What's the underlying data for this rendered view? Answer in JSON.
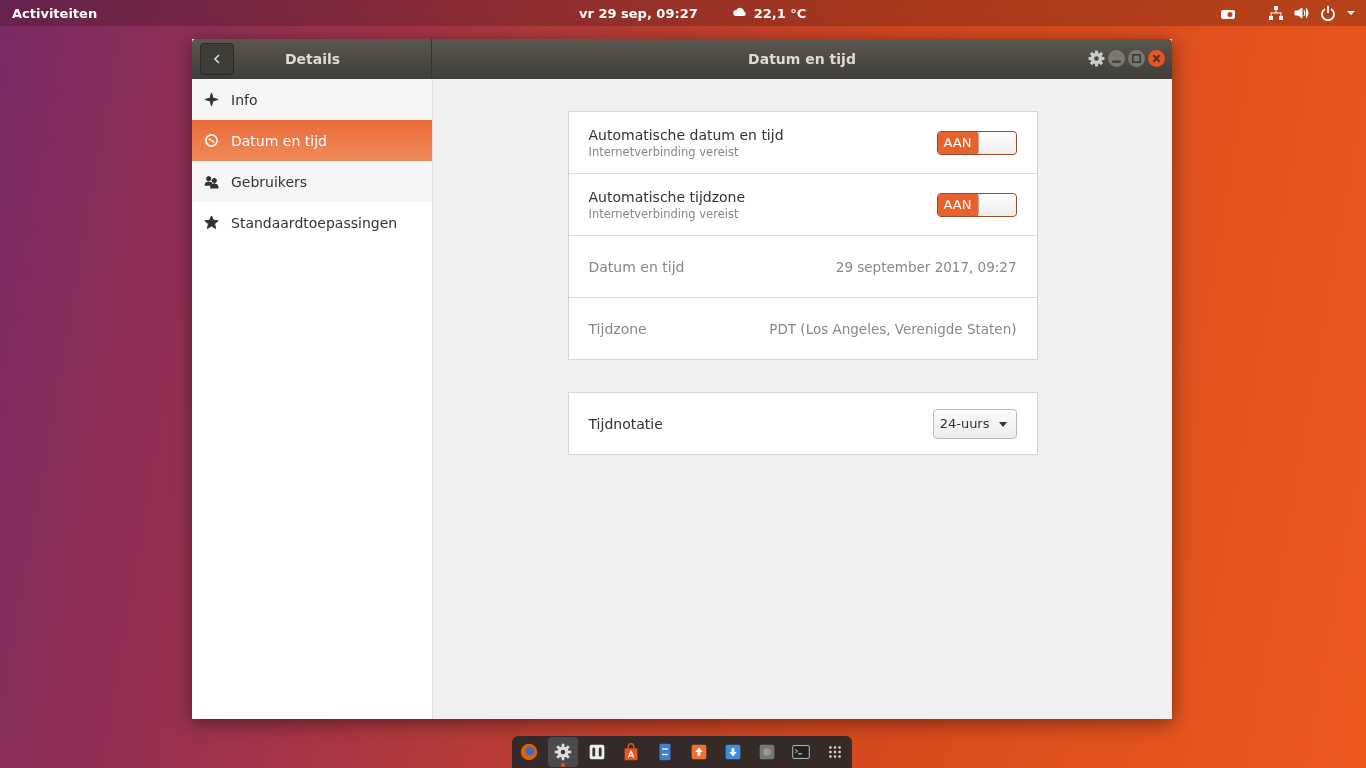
{
  "top_bar": {
    "activities": "Activiteiten",
    "clock": "vr 29 sep, 09:27",
    "weather": "22,1 °C"
  },
  "window": {
    "sidebar_title": "Details",
    "title": "Datum en tijd"
  },
  "sidebar": {
    "items": [
      {
        "label": "Info",
        "selected": false
      },
      {
        "label": "Datum en tijd",
        "selected": true
      },
      {
        "label": "Gebruikers",
        "selected": false
      },
      {
        "label": "Standaardtoepassingen",
        "selected": false
      }
    ]
  },
  "groups": [
    {
      "rows": [
        {
          "kind": "toggle",
          "label": "Automatische datum en tijd",
          "subtitle": "Internetverbinding vereist",
          "on": true,
          "state_text": "AAN"
        },
        {
          "kind": "toggle",
          "label": "Automatische tijdzone",
          "subtitle": "Internetverbinding vereist",
          "on": true,
          "state_text": "AAN"
        },
        {
          "kind": "value",
          "label": "Datum en tijd",
          "value": "29 september 2017, 09:27"
        },
        {
          "kind": "value",
          "label": "Tijdzone",
          "value": "PDT (Los Angeles, Verenigde Staten)"
        }
      ]
    },
    {
      "rows": [
        {
          "kind": "dropdown",
          "label": "Tijdnotatie",
          "value": "24-uurs"
        }
      ]
    }
  ],
  "dock": [
    {
      "active": false
    },
    {
      "active": true
    },
    {
      "active": false
    },
    {
      "active": false
    },
    {
      "active": false
    },
    {
      "active": false
    },
    {
      "active": false
    },
    {
      "active": false
    },
    {
      "active": false
    },
    {
      "active": false
    }
  ]
}
